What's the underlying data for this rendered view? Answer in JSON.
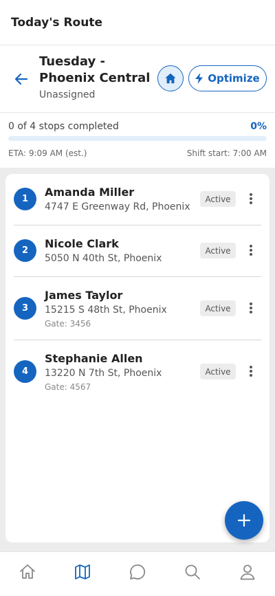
{
  "header": {
    "title": "Today's Route"
  },
  "route": {
    "name": "Tuesday - Phoenix Central",
    "assignment": "Unassigned",
    "optimize_label": "Optimize"
  },
  "progress": {
    "summary": "0 of 4 stops completed",
    "percent_label": "0%",
    "percent": 0,
    "eta": "ETA: 9:09 AM (est.)",
    "shift_start": "Shift start: 7:00 AM"
  },
  "stops": [
    {
      "number": "1",
      "name": "Amanda Miller",
      "address": "4747 E Greenway Rd, Phoenix",
      "gate": "",
      "status": "Active"
    },
    {
      "number": "2",
      "name": "Nicole Clark",
      "address": "5050 N 40th St, Phoenix",
      "gate": "",
      "status": "Active"
    },
    {
      "number": "3",
      "name": "James Taylor",
      "address": "15215 S 48th St, Phoenix",
      "gate": "Gate: 3456",
      "status": "Active"
    },
    {
      "number": "4",
      "name": "Stephanie Allen",
      "address": "13220 N 7th St, Phoenix",
      "gate": "Gate: 4567",
      "status": "Active"
    }
  ],
  "nav": {
    "items": [
      "home-icon",
      "map-icon",
      "chat-icon",
      "search-icon",
      "profile-icon"
    ],
    "active": "map-icon"
  },
  "colors": {
    "accent": "#1565c0",
    "accent_light": "#e3eefb"
  }
}
